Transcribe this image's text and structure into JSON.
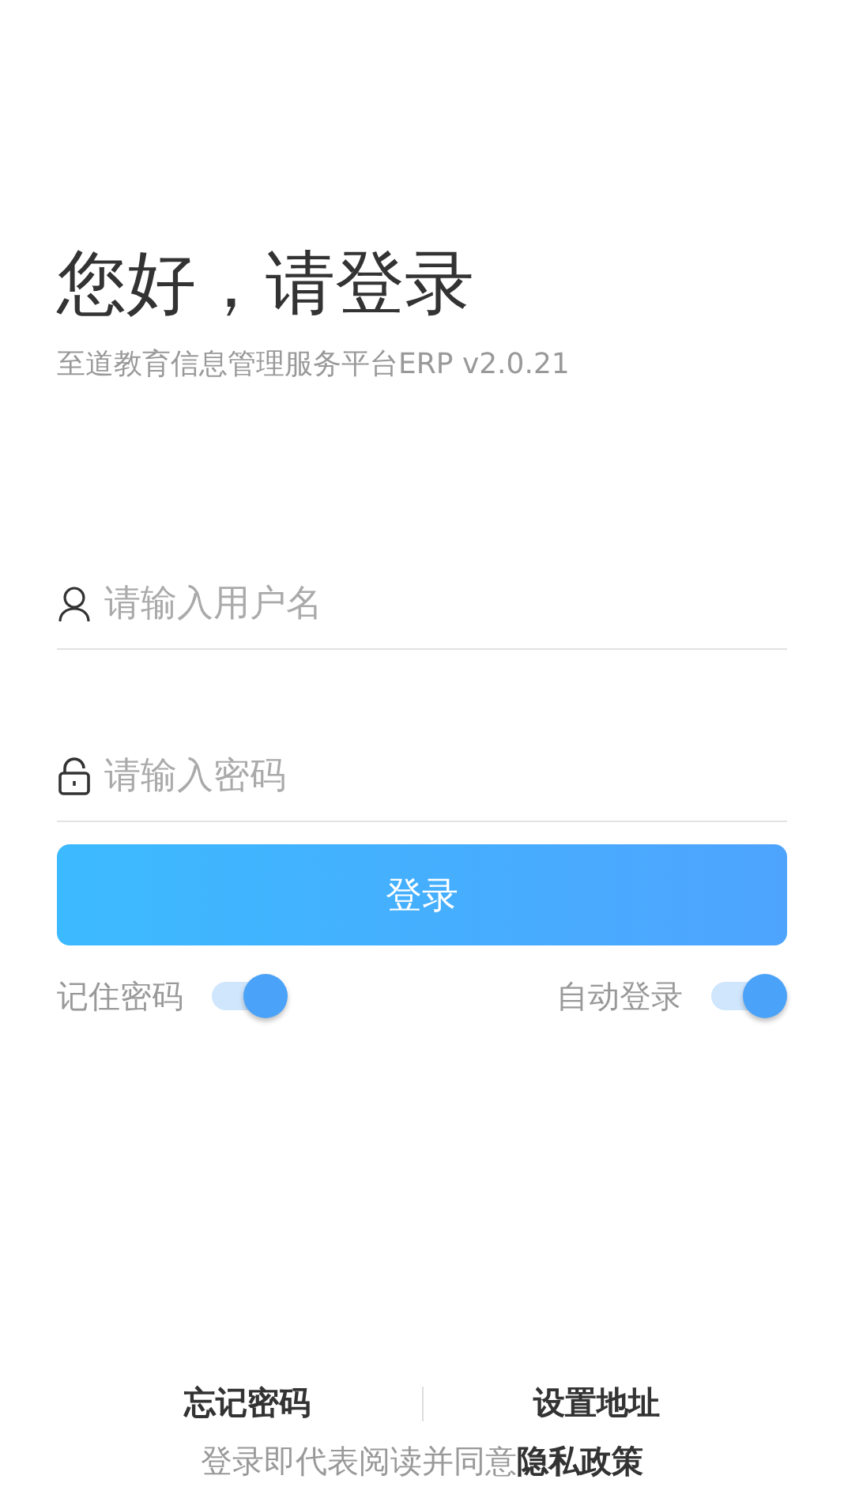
{
  "header": {
    "title": "您好，请登录",
    "subtitle": "至道教育信息管理服务平台ERP v2.0.21"
  },
  "fields": [
    {
      "kind": "user",
      "placeholder": "请输入用户名"
    },
    {
      "kind": "password",
      "placeholder": "请输入密码"
    }
  ],
  "login_button": "登录",
  "toggles": [
    {
      "label": "记住密码",
      "on": true
    },
    {
      "label": "自动登录",
      "on": true
    }
  ],
  "footer": {
    "links": [
      "忘记密码",
      "设置地址"
    ],
    "agreement": "登录即代表阅读并同意",
    "policy_link": "隐私政策"
  }
}
